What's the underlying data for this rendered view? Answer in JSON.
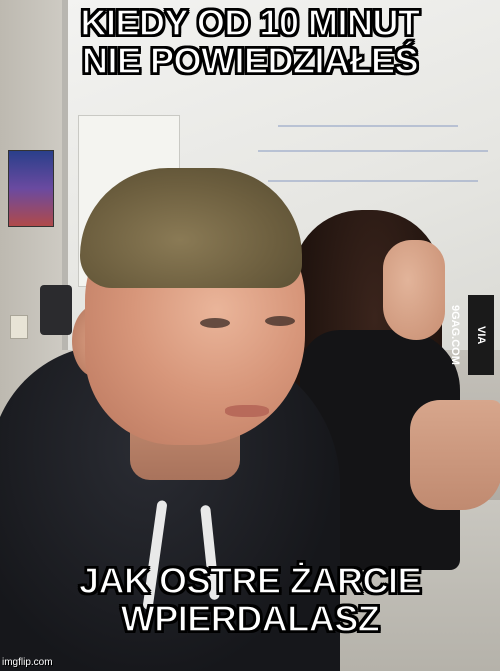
{
  "meme": {
    "top_text": "KIEDY OD 10 MINUT\nNIE POWIEDZIAŁEŚ",
    "bottom_text": "JAK OSTRE ŻARCIE\nWPIERDALASZ"
  },
  "watermarks": {
    "side": "VIA 9GAG.COM",
    "corner": "imgflip.com"
  }
}
